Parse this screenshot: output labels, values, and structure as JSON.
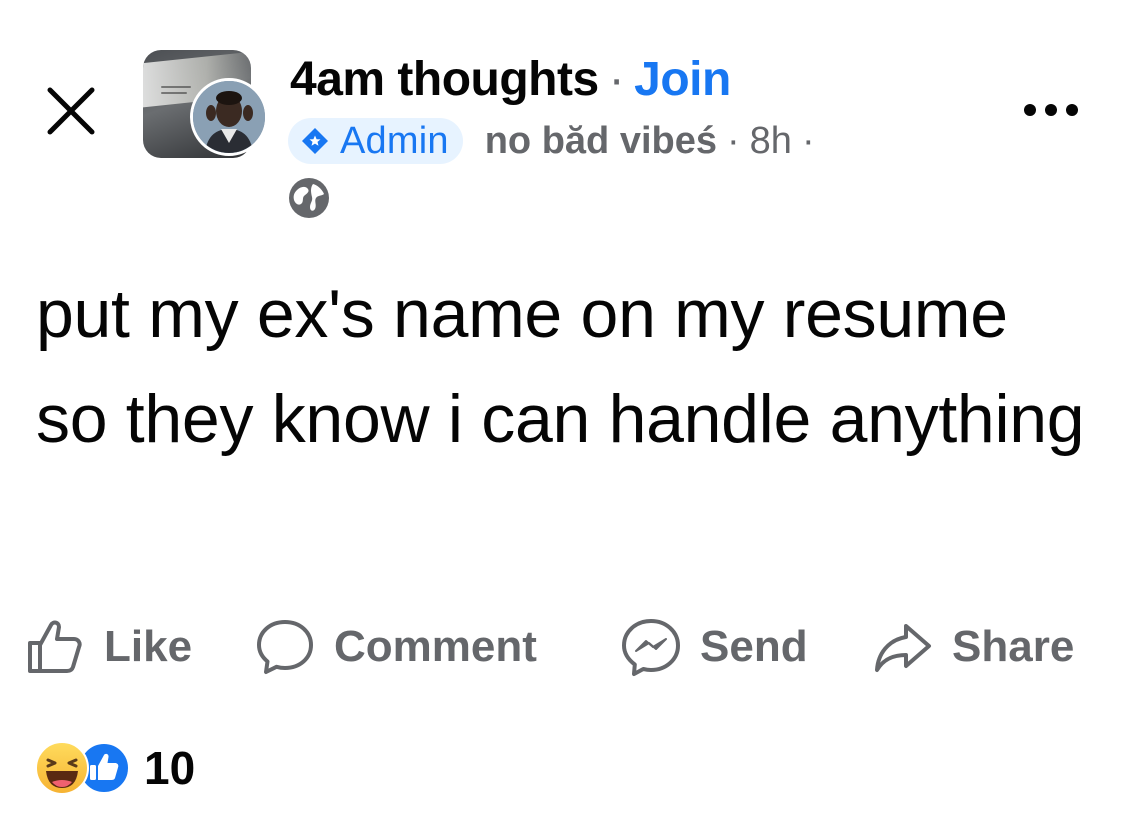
{
  "header": {
    "group_name": "4am thoughts",
    "separator": "·",
    "join_label": "Join",
    "admin_label": "Admin",
    "author": "no băd vibeś",
    "time": "8h",
    "time_separator": "·",
    "privacy_icon": "globe-icon",
    "close_icon": "close-icon",
    "more_icon": "more-horizontal-icon"
  },
  "post": {
    "text": "put my ex's name on my resume so they know i can handle anything"
  },
  "actions": [
    {
      "label": "Like",
      "icon": "thumbs-up-icon"
    },
    {
      "label": "Comment",
      "icon": "comment-bubble-icon"
    },
    {
      "label": "Send",
      "icon": "messenger-icon"
    },
    {
      "label": "Share",
      "icon": "share-arrow-icon"
    }
  ],
  "reactions": {
    "icons": [
      "haha-emoji-icon",
      "like-reaction-icon"
    ],
    "count": "10"
  },
  "colors": {
    "brand_blue": "#1877f2",
    "admin_bg": "#e7f3ff",
    "secondary_text": "#65676b",
    "primary_text": "#050505"
  }
}
